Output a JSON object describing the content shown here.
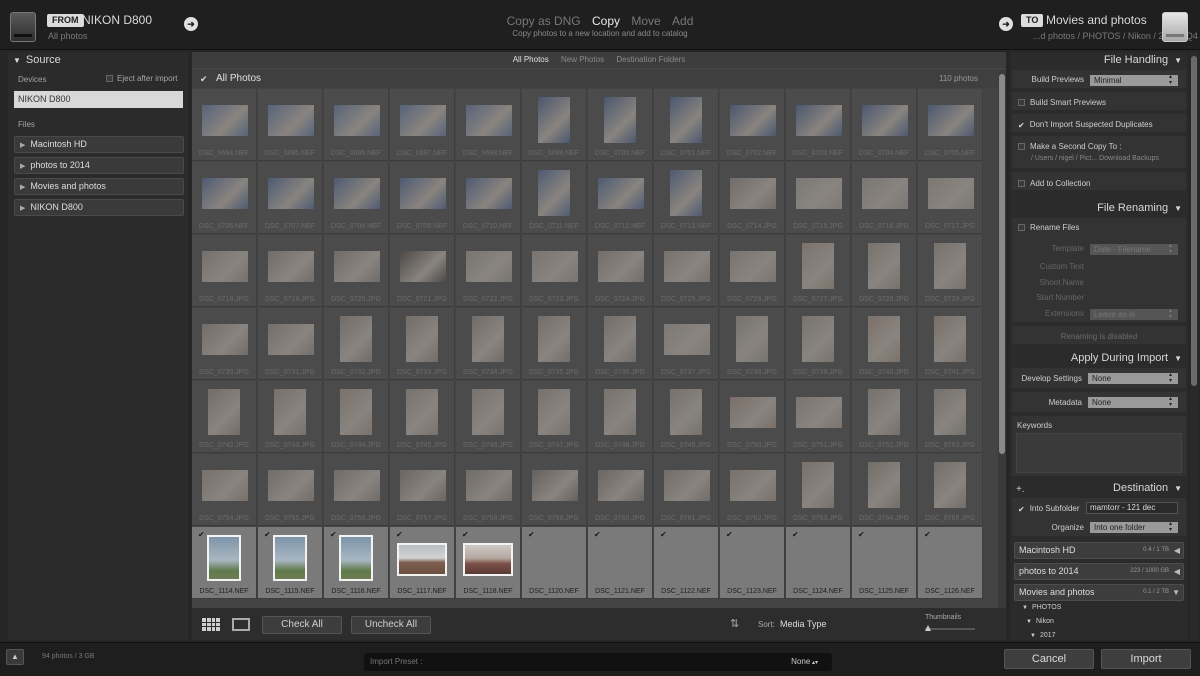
{
  "header": {
    "from_tag": "FROM",
    "source_name": "NIKON D800",
    "source_sub": "All photos",
    "modes": [
      "Copy as DNG",
      "Copy",
      "Move",
      "Add"
    ],
    "active_mode": "Copy",
    "mode_description": "Copy photos to a new location and add to catalog",
    "to_tag": "TO",
    "dest_name": "Movies and photos",
    "dest_path": "...d photos / PHOTOS / Nikon / 2017 / Q4"
  },
  "source_panel": {
    "title": "Source",
    "devices_label": "Devices",
    "eject_label": "Eject after import",
    "device": "NIKON D800",
    "files_label": "Files",
    "volumes": [
      "Macintosh HD",
      "photos to 2014",
      "Movies and photos",
      "NIKON D800"
    ]
  },
  "center": {
    "tabs": [
      "All Photos",
      "New Photos",
      "Destination Folders"
    ],
    "active_tab": "All Photos",
    "all_photos_label": "All Photos",
    "photo_count": "110 photos",
    "rows": [
      [
        "DSC_0694.NEF",
        "DSC_0695.NEF",
        "DSC_0696.NEF",
        "DSC_0697.NEF",
        "DSC_0698.NEF",
        "DSC_0699.NEF",
        "DSC_0700.NEF",
        "DSC_0701.NEF",
        "DSC_0702.NEF",
        "DSC_0703.NEF",
        "DSC_0704.NEF",
        "DSC_0705.NEF"
      ],
      [
        "DSC_0706.NEF",
        "DSC_0707.NEF",
        "DSC_0708.NEF",
        "DSC_0709.NEF",
        "DSC_0710.NEF",
        "DSC_0711.NEF",
        "DSC_0712.NEF",
        "DSC_0713.NEF",
        "DSC_0714.JPG",
        "DSC_0715.JPG",
        "DSC_0716.JPG",
        "DSC_0717.JPG"
      ],
      [
        "DSC_0718.JPG",
        "DSC_0719.JPG",
        "DSC_0720.JPG",
        "DSC_0721.JPG",
        "DSC_0722.JPG",
        "DSC_0723.JPG",
        "DSC_0724.JPG",
        "DSC_0725.JPG",
        "DSC_0726.JPG",
        "DSC_0727.JPG",
        "DSC_0728.JPG",
        "DSC_0729.JPG"
      ],
      [
        "DSC_0730.JPG",
        "DSC_0731.JPG",
        "DSC_0732.JPG",
        "DSC_0733.JPG",
        "DSC_0734.JPG",
        "DSC_0735.JPG",
        "DSC_0736.JPG",
        "DSC_0737.JPG",
        "DSC_0738.JPG",
        "DSC_0739.JPG",
        "DSC_0740.JPG",
        "DSC_0741.JPG"
      ],
      [
        "DSC_0742.JPG",
        "DSC_0743.JPG",
        "DSC_0744.JPG",
        "DSC_0745.JPG",
        "DSC_0746.JPG",
        "DSC_0747.JPG",
        "DSC_0748.JPG",
        "DSC_0749.JPG",
        "DSC_0750.JPG",
        "DSC_0751.JPG",
        "DSC_0752.JPG",
        "DSC_0753.JPG"
      ],
      [
        "DSC_0754.JPG",
        "DSC_0755.JPG",
        "DSC_0756.JPG",
        "DSC_0757.JPG",
        "DSC_0758.JPG",
        "DSC_0759.JPG",
        "DSC_0760.JPG",
        "DSC_0761.JPG",
        "DSC_0762.JPG",
        "DSC_0763.JPG",
        "DSC_0764.JPG",
        "DSC_0765.JPG"
      ],
      [
        "DSC_1114.NEF",
        "DSC_1115.NEF",
        "DSC_1116.NEF",
        "DSC_1117.NEF",
        "DSC_1118.NEF",
        "DSC_1120.NEF",
        "DSC_1121.NEF",
        "DSC_1122.NEF",
        "DSC_1123.NEF",
        "DSC_1124.NEF",
        "DSC_1125.NEF",
        "DSC_1126.NEF"
      ]
    ],
    "check_all": "Check All",
    "uncheck_all": "Uncheck All",
    "sort_label": "Sort:",
    "sort_value": "Media Type",
    "thumbnails_label": "Thumbnails"
  },
  "right_panel": {
    "file_handling": {
      "title": "File Handling",
      "build_previews_label": "Build Previews",
      "build_previews_value": "Minimal",
      "smart_previews": "Build Smart Previews",
      "dont_import_dupes": "Don't Import Suspected Duplicates",
      "second_copy": "Make a Second Copy To :",
      "second_copy_path": "/ Users / nigel / Pict... Download Backups",
      "add_to_collection": "Add to Collection"
    },
    "file_renaming": {
      "title": "File Renaming",
      "rename_files": "Rename Files",
      "template_label": "Template",
      "template_value": "Date - Filename",
      "custom_text": "Custom Text",
      "shoot_name": "Shoot Name",
      "start_number": "Start Number",
      "extensions_label": "Extensions",
      "extensions_value": "Leave as-is",
      "disabled_note": "Renaming is disabled"
    },
    "apply": {
      "title": "Apply During Import",
      "develop_label": "Develop Settings",
      "develop_value": "None",
      "metadata_label": "Metadata",
      "metadata_value": "None",
      "keywords_label": "Keywords"
    },
    "destination": {
      "plus": "+.",
      "title": "Destination",
      "into_subfolder": "Into Subfolder",
      "subfolder_value": "mamtorr - 121 dec",
      "organize_label": "Organize",
      "organize_value": "Into one folder",
      "volumes": [
        {
          "name": "Macintosh HD",
          "size": "0.4 / 1 TB"
        },
        {
          "name": "photos to 2014",
          "size": "223 / 1000 GB"
        },
        {
          "name": "Movies and photos",
          "size": "0.1 / 2 TB"
        }
      ],
      "tree": [
        "PHOTOS",
        "Nikon",
        "2017"
      ]
    }
  },
  "bottom": {
    "info": "94 photos / 3 GB",
    "preset_label": "Import Preset :",
    "preset_value": "None",
    "cancel": "Cancel",
    "import": "Import"
  }
}
